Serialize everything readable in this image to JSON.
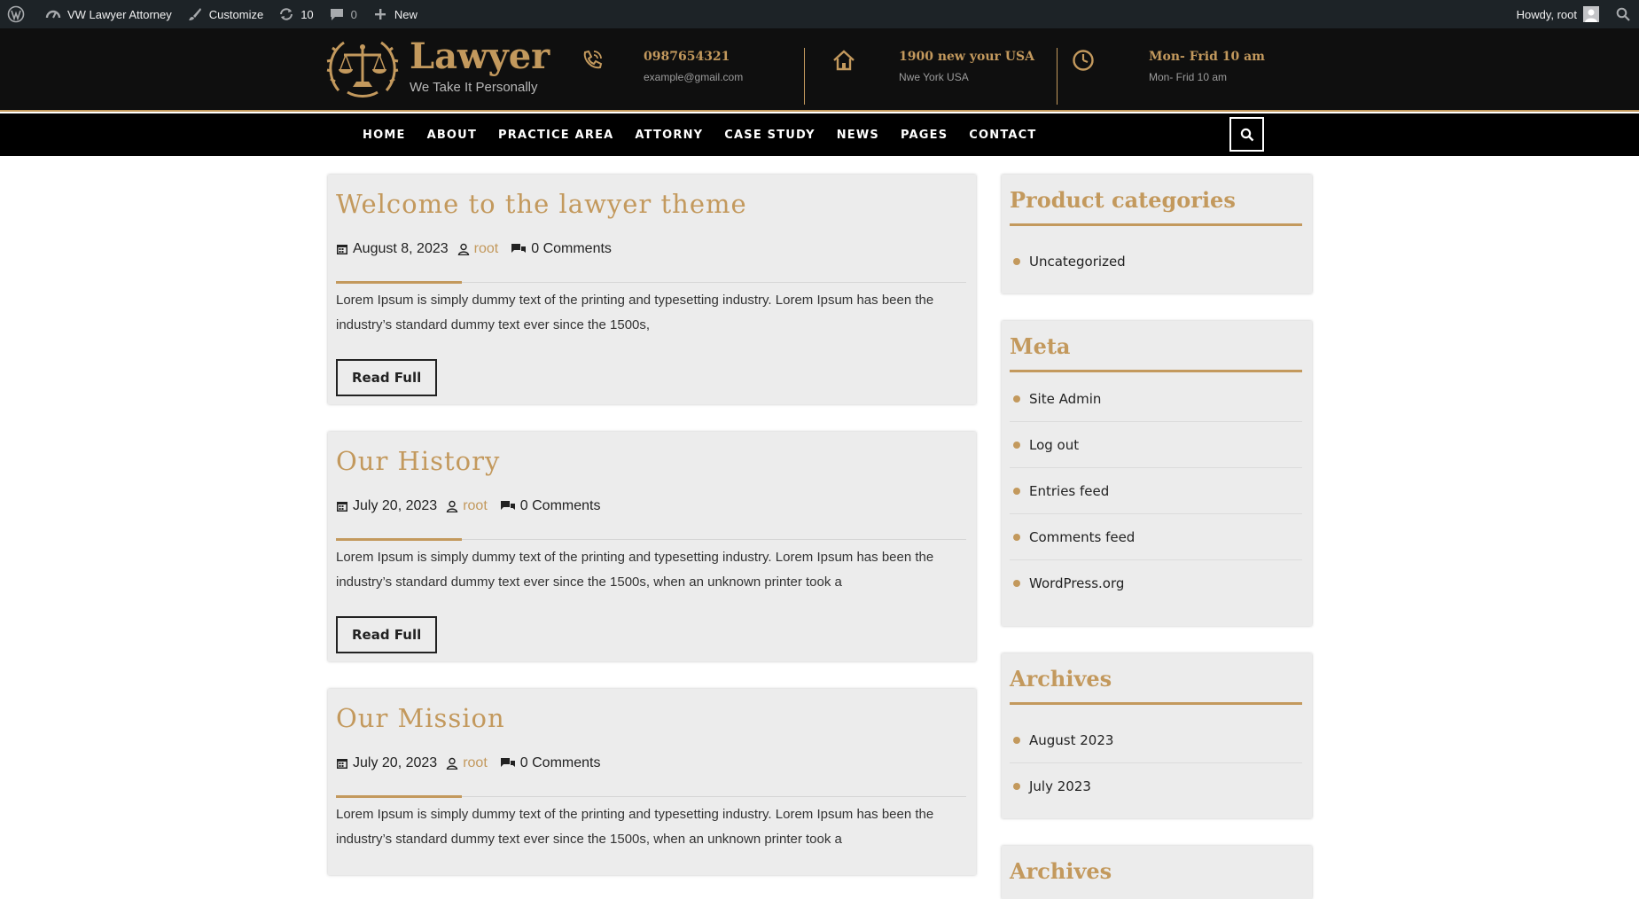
{
  "adminbar": {
    "site_name": "VW Lawyer Attorney",
    "customize": "Customize",
    "updates_count": "10",
    "comments_count": "0",
    "new_label": "New",
    "howdy": "Howdy, root"
  },
  "header": {
    "brand_title": "Lawyer",
    "brand_tagline": "We Take It Personally",
    "phone": "0987654321",
    "email": "example@gmail.com",
    "address": "1900 new your USA",
    "address_sub": "Nwe York USA",
    "hours": "Mon- Frid 10 am",
    "hours_sub": "Mon- Frid 10 am"
  },
  "nav": {
    "items": [
      "HOME",
      "ABOUT",
      "PRACTICE AREA",
      "ATTORNY",
      "CASE STUDY",
      "NEWS",
      "PAGES",
      "CONTACT"
    ]
  },
  "posts": [
    {
      "title": "Welcome to the lawyer theme",
      "date": "August 8, 2023",
      "author": "root",
      "comments": "0 Comments",
      "excerpt": "Lorem Ipsum is simply dummy text of the printing and typesetting industry. Lorem Ipsum has been the industry’s standard dummy text ever since the 1500s,",
      "read_label": "Read Full"
    },
    {
      "title": "Our History",
      "date": "July 20, 2023",
      "author": "root",
      "comments": "0 Comments",
      "excerpt": "Lorem Ipsum is simply dummy text of the printing and typesetting industry. Lorem Ipsum has been the industry’s standard dummy text ever since the 1500s, when an unknown printer took a",
      "read_label": "Read Full"
    },
    {
      "title": "Our Mission",
      "date": "July 20, 2023",
      "author": "root",
      "comments": "0 Comments",
      "excerpt": "Lorem Ipsum is simply dummy text of the printing and typesetting industry. Lorem Ipsum has been the industry’s standard dummy text ever since the 1500s, when an unknown printer took a"
    }
  ],
  "sidebar": {
    "product_categories": {
      "title": "Product categories",
      "items": [
        "Uncategorized"
      ]
    },
    "meta": {
      "title": "Meta",
      "items": [
        "Site Admin",
        "Log out",
        "Entries feed",
        "Comments feed",
        "WordPress.org"
      ]
    },
    "archives": {
      "title": "Archives",
      "items": [
        "August 2023",
        "July 2023"
      ]
    },
    "next_widget_title": "Archives"
  },
  "colors": {
    "accent": "#c3995d",
    "header_bg": "#0f0f0f",
    "nav_bg": "#000000",
    "adminbar_bg": "#1d2327",
    "card_bg": "#ececec"
  },
  "icons": {
    "adminbar": [
      "wordpress-icon",
      "dashboard-icon",
      "brush-icon",
      "updates-icon",
      "comment-icon",
      "plus-icon",
      "avatar-icon",
      "search-icon"
    ],
    "header": [
      "scales-logo-icon",
      "phone-icon",
      "home-icon",
      "clock-icon"
    ],
    "meta": [
      "calendar-icon",
      "user-icon",
      "comments-icon"
    ]
  }
}
